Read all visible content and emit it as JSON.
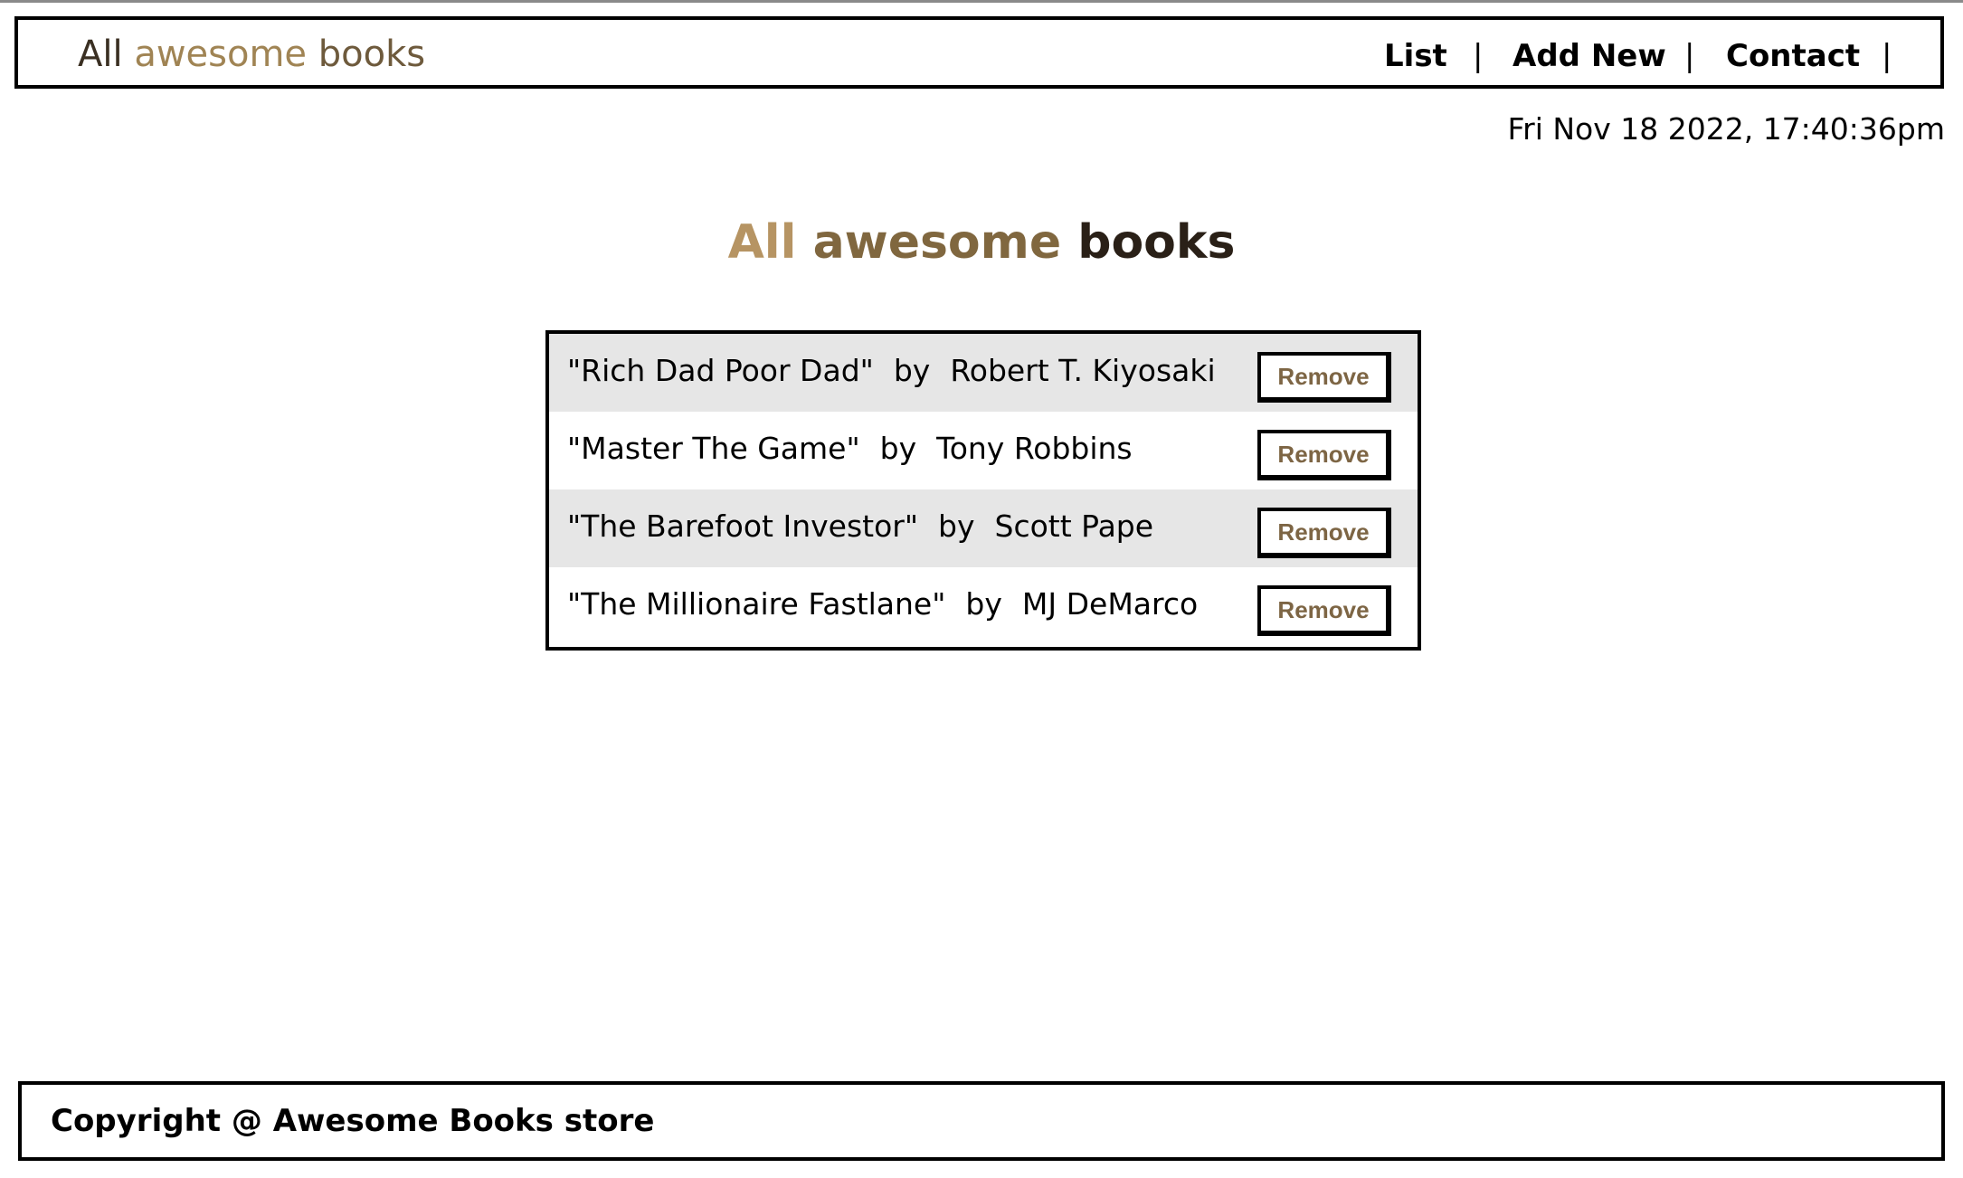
{
  "header": {
    "logo": {
      "word1": "All",
      "word2": "awesome",
      "word3": "books"
    },
    "nav": {
      "list_label": "List",
      "add_new_label": "Add New",
      "contact_label": "Contact",
      "separator": "|"
    }
  },
  "datetime": "Fri Nov 18 2022, 17:40:36pm",
  "main": {
    "title": {
      "word1": "All",
      "word2": "awesome",
      "word3": "books"
    },
    "books": [
      {
        "title": "\"Rich Dad Poor Dad\"",
        "by": "by",
        "author": "Robert T. Kiyosaki",
        "remove_label": "Remove"
      },
      {
        "title": "\"Master The Game\"",
        "by": "by",
        "author": "Tony Robbins",
        "remove_label": "Remove"
      },
      {
        "title": "\"The Barefoot Investor\"",
        "by": "by",
        "author": "Scott Pape",
        "remove_label": "Remove"
      },
      {
        "title": "\"The Millionaire Fastlane\"",
        "by": "by",
        "author": "MJ DeMarco",
        "remove_label": "Remove"
      }
    ]
  },
  "footer": {
    "copyright": "Copyright @ Awesome Books store"
  },
  "colors": {
    "gold_light": "#b69463",
    "gold_mid": "#80673f",
    "gold_dark": "#2a2017",
    "row_shade": "#e6e6e6",
    "border": "#000000"
  }
}
